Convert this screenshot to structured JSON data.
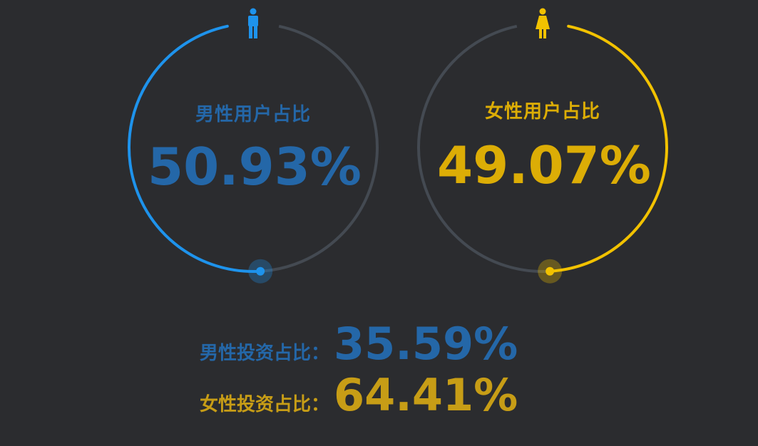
{
  "theme": {
    "background": "#2b2c2f",
    "track": "#444a52",
    "male_color": "#1e93ec",
    "male_text": "#2467a8",
    "female_color": "#f2c200",
    "female_text": "#dcad06",
    "female_text_small": "#c79d16"
  },
  "chart_data": {
    "type": "pie",
    "title": "",
    "gauges": [
      {
        "label": "男性用户占比",
        "value_text": "50.93%",
        "value": 50.93,
        "color": "#1e93ec",
        "icon": "male-person-icon",
        "direction": "counterclockwise"
      },
      {
        "label": "女性用户占比",
        "value_text": "49.07%",
        "value": 49.07,
        "color": "#f2c200",
        "icon": "female-person-icon",
        "direction": "clockwise"
      }
    ]
  },
  "stats": [
    {
      "label": "男性投资占比：",
      "value": "35.59%"
    },
    {
      "label": "女性投资占比：",
      "value": "64.41%"
    }
  ]
}
